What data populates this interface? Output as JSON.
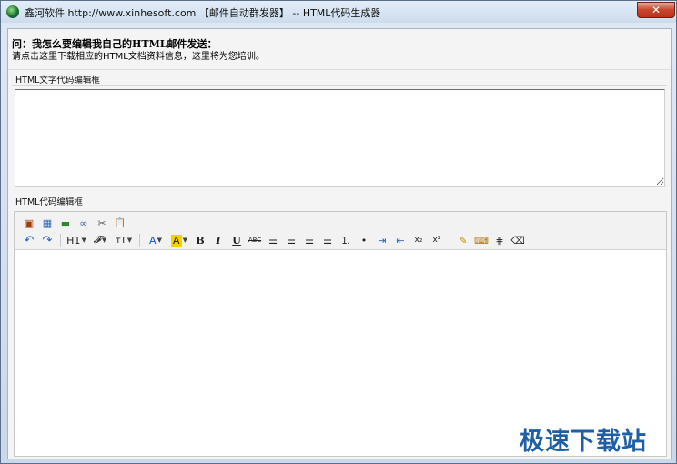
{
  "window": {
    "title": "鑫河软件 http://www.xinhesoft.com 【邮件自动群发器】 -- HTML代码生成器",
    "close_symbol": "✕"
  },
  "intro": {
    "question": "问：我怎么要编辑我自己的HTML邮件发送：",
    "hint": "请点击这里下载相应的HTML文档资料信息，这里将为您培训。"
  },
  "sections": {
    "text_editor_label": "HTML文字代码编辑框",
    "code_editor_label": "HTML代码编辑框"
  },
  "toolbar": {
    "row1": [
      {
        "name": "insert-image-icon",
        "glyph": "▣"
      },
      {
        "name": "insert-table-icon",
        "glyph": "▦"
      },
      {
        "name": "insert-hr-icon",
        "glyph": "▬"
      },
      {
        "name": "insert-link-icon",
        "glyph": "∞"
      },
      {
        "name": "unlink-icon",
        "glyph": "✂"
      },
      {
        "name": "paste-icon",
        "glyph": "📋"
      }
    ],
    "row2": {
      "undo": "↶",
      "redo": "↷",
      "heading": "H1",
      "font": "𝓕",
      "font_size": "тT",
      "font_color": "A",
      "highlight": "A",
      "bold": "B",
      "italic": "I",
      "underline": "U",
      "strike": "ABC",
      "align_left": "☰",
      "align_center": "☰",
      "align_right": "☰",
      "align_justify": "☰",
      "ordered_list": "⒈",
      "unordered_list": "•",
      "indent": "⇥",
      "outdent": "⇤",
      "subscript": "x₂",
      "superscript": "x²",
      "clean": "✎",
      "source": "⌨",
      "grid": "⋕",
      "eraser": "⌫"
    },
    "colors": {
      "font_color": "#1b55d1",
      "highlight": "#f4d000",
      "drop": "#444444"
    }
  },
  "watermark": {
    "text": "极速下载站"
  }
}
